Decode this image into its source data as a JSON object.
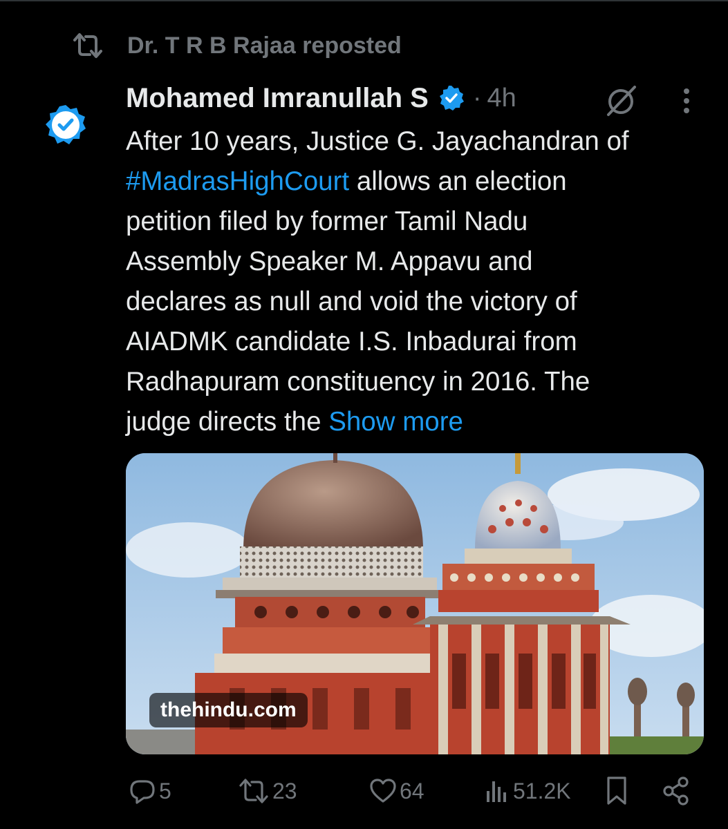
{
  "repost": {
    "text": "Dr. T R B Rajaa reposted",
    "icon": "repost-icon"
  },
  "author": {
    "name": "Mohamed Imranullah S",
    "verified": true,
    "separator": "·",
    "time": "4h",
    "badge_color": "#1d9bf0"
  },
  "tweet": {
    "lines": [
      {
        "t": "After 10 years, Justice G. Jayachandran of"
      },
      {
        "h": "#MadrasHighCourt",
        "t": " allows an election"
      },
      {
        "t": "petition filed by former Tamil Nadu"
      },
      {
        "t": "Assembly Speaker M. Appavu and"
      },
      {
        "t": "declares as null and void the victory of"
      },
      {
        "t": "AIADMK candidate I.S. Inbadurai from"
      },
      {
        "t": "Radhapuram constituency in 2016. The"
      },
      {
        "t": "judge directs the ",
        "s": "Show more"
      }
    ]
  },
  "media": {
    "source": "thehindu.com"
  },
  "actions": {
    "replies": "5",
    "reposts": "23",
    "likes": "64",
    "views": "51.2K"
  },
  "colors": {
    "accent": "#1d9bf0",
    "muted": "#71767b",
    "text": "#e7e9ea",
    "background": "#000000"
  }
}
